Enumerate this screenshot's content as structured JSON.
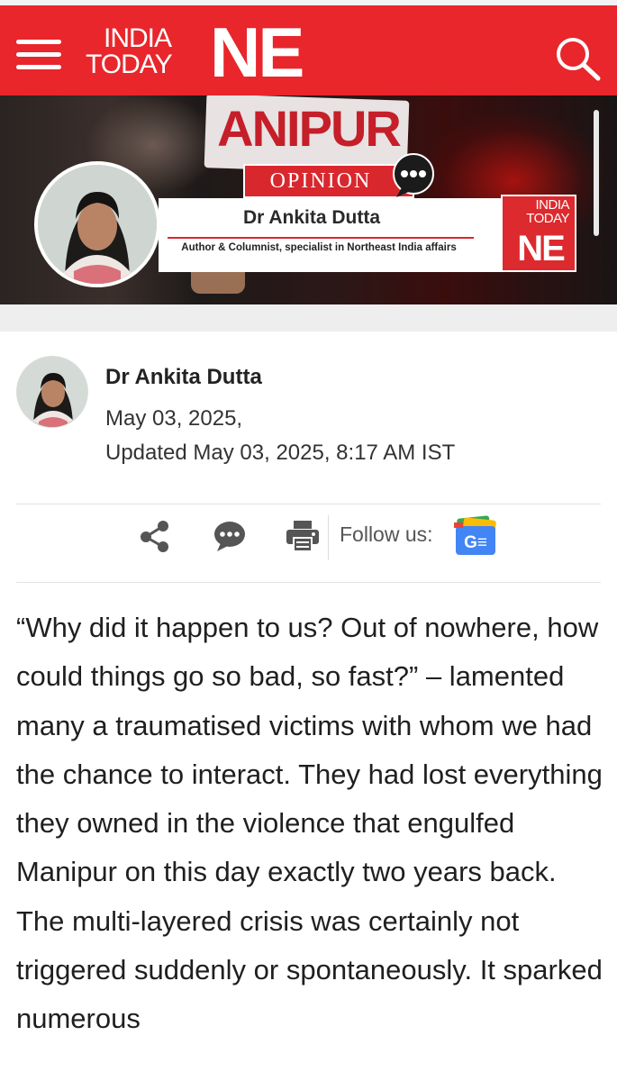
{
  "header": {
    "logo_line1": "INDIA",
    "logo_line2": "TODAY",
    "logo_ne": "NE"
  },
  "banner": {
    "placard_text": "ANIPUR",
    "opinion_label": "OPINION",
    "author_name": "Dr Ankita Dutta",
    "author_description": "Author & Columnist, specialist in Northeast India affairs",
    "mini_logo_line1": "INDIA",
    "mini_logo_line2": "TODAY",
    "mini_logo_ne": "NE"
  },
  "byline": {
    "author_name": "Dr Ankita Dutta",
    "date": "May 03, 2025,",
    "updated": "Updated May 03, 2025, 8:17 AM IST"
  },
  "share_bar": {
    "follow_label": "Follow us:",
    "gnews_text": "G≡"
  },
  "article": {
    "paragraph": "“Why did it happen to us? Out of nowhere, how could things go so bad, so fast?” – lamented many a traumatised victims with whom we had the chance to interact. They had lost everything they owned in the violence that engulfed Manipur on this day exactly two years back. The multi-layered crisis was certainly not triggered suddenly or spontaneously. It sparked numerous"
  },
  "colors": {
    "brand_red": "#e8262b",
    "text_dark": "#222222",
    "icon_gray": "#555555"
  }
}
